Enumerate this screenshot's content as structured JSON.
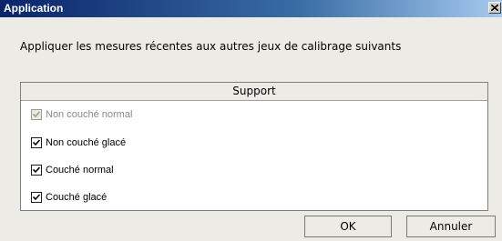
{
  "window": {
    "title": "Application"
  },
  "prompt": "Appliquer les mesures récentes aux autres jeux de calibrage suivants",
  "list": {
    "header": "Support",
    "items": [
      {
        "label": "Non couché normal",
        "checked": true,
        "disabled": true
      },
      {
        "label": "Non couché glacé",
        "checked": true,
        "disabled": false
      },
      {
        "label": "Couché normal",
        "checked": true,
        "disabled": false
      },
      {
        "label": "Couché glacé",
        "checked": true,
        "disabled": false
      }
    ]
  },
  "buttons": {
    "ok": "OK",
    "cancel": "Annuler"
  },
  "icons": {
    "close": "close-icon",
    "check": "check-icon"
  },
  "colors": {
    "titlebar_start": "#0a246a",
    "titlebar_end": "#a6caf0",
    "dialog_bg": "#ecebe6"
  }
}
